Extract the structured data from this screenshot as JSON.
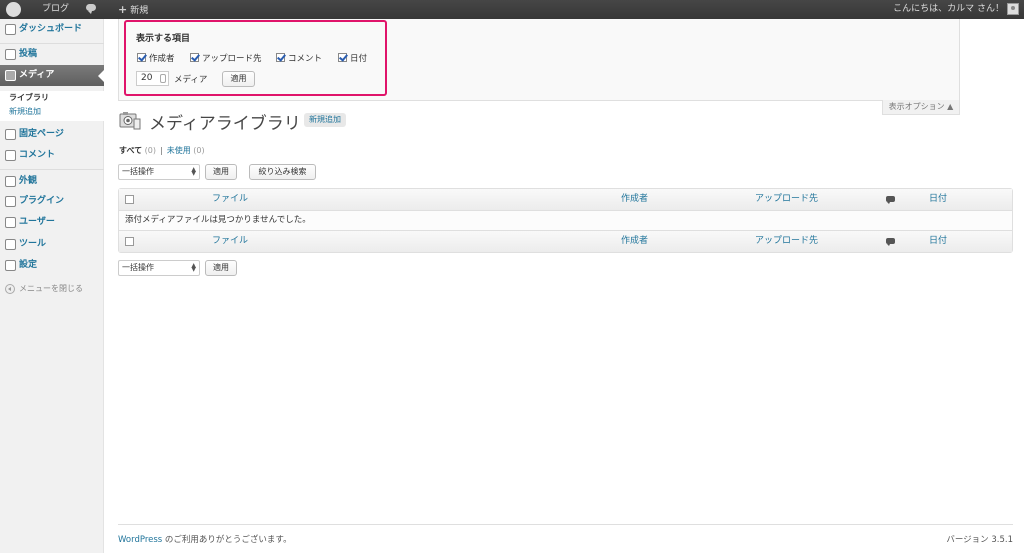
{
  "adminbar": {
    "logo": "W",
    "site_name": "ブログ",
    "new_label": "新規",
    "greeting": "こんにちは、カルマ さん！"
  },
  "sidebar": {
    "items": [
      {
        "label": "ダッシュボード",
        "icon": "dashboard-icon"
      },
      {
        "label": "投稿",
        "icon": "posts-icon"
      },
      {
        "label": "メディア",
        "icon": "media-icon"
      },
      {
        "label": "固定ページ",
        "icon": "pages-icon"
      },
      {
        "label": "コメント",
        "icon": "comments-icon"
      },
      {
        "label": "外観",
        "icon": "appearance-icon"
      },
      {
        "label": "プラグイン",
        "icon": "plugins-icon"
      },
      {
        "label": "ユーザー",
        "icon": "users-icon"
      },
      {
        "label": "ツール",
        "icon": "tools-icon"
      },
      {
        "label": "設定",
        "icon": "settings-icon"
      }
    ],
    "submenu": [
      "ライブラリ",
      "新規追加"
    ],
    "collapse": "メニューを閉じる"
  },
  "screen_options": {
    "title": "表示する項目",
    "columns": [
      {
        "label": "作成者",
        "checked": true
      },
      {
        "label": "アップロード先",
        "checked": true
      },
      {
        "label": "コメント",
        "checked": true
      },
      {
        "label": "日付",
        "checked": true
      }
    ],
    "per_page_value": "20",
    "per_page_label": "メディア",
    "apply": "適用",
    "toggle": "表示オプション ▲"
  },
  "page": {
    "title": "メディアライブラリ",
    "add_new": "新規追加",
    "filter_all": "すべて",
    "filter_all_count": "(0)",
    "filter_unattached": "未使用",
    "filter_unattached_count": "(0)",
    "bulk_action": "一括操作",
    "apply": "適用",
    "search_filter": "絞り込み検索"
  },
  "table": {
    "columns": {
      "file": "ファイル",
      "author": "作成者",
      "uploaded_to": "アップロード先",
      "date": "日付"
    },
    "empty_message": "添付メディアファイルは見つかりませんでした。"
  },
  "footer": {
    "wordpress": "WordPress",
    "thanks": " のご利用ありがとうございます。",
    "version": "バージョン 3.5.1"
  },
  "colors": {
    "link": "#21759b",
    "highlight": "#e0146a",
    "adminbar": "#464646"
  }
}
